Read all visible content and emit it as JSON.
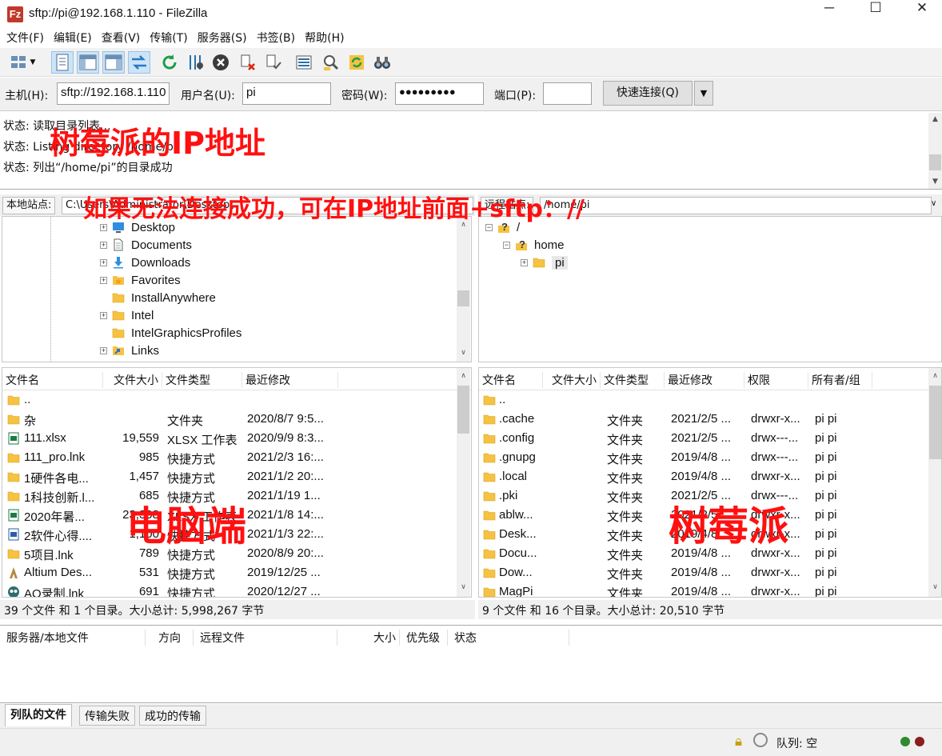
{
  "window": {
    "title": "sftp://pi@192.168.1.110 - FileZilla",
    "app_icon_letter": "Fz",
    "minimize": "─",
    "maximize": "☐",
    "close": "✕"
  },
  "menu": [
    "文件(F)",
    "编辑(E)",
    "查看(V)",
    "传输(T)",
    "服务器(S)",
    "书签(B)",
    "帮助(H)"
  ],
  "quickconnect": {
    "host_label": "主机(H):",
    "host_value": "sftp://192.168.1.110",
    "user_label": "用户名(U):",
    "user_value": "pi",
    "pass_label": "密码(W):",
    "pass_value": "●●●●●●●●●",
    "port_label": "端口(P):",
    "port_value": "",
    "connect_button": "快速连接(Q)",
    "dropdown": "▼"
  },
  "log": [
    {
      "prefix": "状态:",
      "text": "读取目录列表..."
    },
    {
      "prefix": "状态:",
      "text": "Listing directory /home/pi"
    },
    {
      "prefix": "状态:",
      "text": "列出“/home/pi”的目录成功"
    }
  ],
  "local_site": {
    "label": "本地站点:",
    "path": "C:\\Users\\Administrator\\Desktop\\"
  },
  "remote_site": {
    "label": "远程站点:",
    "path": "/home/pi"
  },
  "local_tree": [
    {
      "name": "Desktop",
      "expander": "+",
      "icon": "desktop-icon"
    },
    {
      "name": "Documents",
      "expander": "+",
      "icon": "document-icon"
    },
    {
      "name": "Downloads",
      "expander": "+",
      "icon": "download-icon"
    },
    {
      "name": "Favorites",
      "expander": "+",
      "icon": "favorites-icon"
    },
    {
      "name": "InstallAnywhere",
      "expander": "",
      "icon": "folder-icon"
    },
    {
      "name": "Intel",
      "expander": "+",
      "icon": "folder-icon"
    },
    {
      "name": "IntelGraphicsProfiles",
      "expander": "",
      "icon": "folder-icon"
    },
    {
      "name": "Links",
      "expander": "+",
      "icon": "links-icon"
    }
  ],
  "remote_tree": [
    {
      "name": "/",
      "expander": "−",
      "icon": "unknown-folder-icon"
    },
    {
      "name": "home",
      "expander": "−",
      "icon": "unknown-folder-icon"
    },
    {
      "name": "pi",
      "expander": "+",
      "icon": "folder-icon"
    }
  ],
  "local_headers": [
    "文件名",
    "文件大小",
    "文件类型",
    "最近修改"
  ],
  "local_files": [
    {
      "name": "..",
      "size": "",
      "type": "",
      "modified": "",
      "icon": "folder-icon"
    },
    {
      "name": "杂",
      "size": "",
      "type": "文件夹",
      "modified": "2020/8/7 9:5...",
      "icon": "folder-icon"
    },
    {
      "name": "111.xlsx",
      "size": "19,559",
      "type": "XLSX 工作表",
      "modified": "2020/9/9 8:3...",
      "icon": "excel-icon"
    },
    {
      "name": "111_pro.lnk",
      "size": "985",
      "type": "快捷方式",
      "modified": "2021/2/3 16:...",
      "icon": "folder-icon"
    },
    {
      "name": "1硬件各电...",
      "size": "1,457",
      "type": "快捷方式",
      "modified": "2021/1/2 20:...",
      "icon": "folder-icon"
    },
    {
      "name": "1科技创新.l...",
      "size": "685",
      "type": "快捷方式",
      "modified": "2021/1/19 1...",
      "icon": "folder-icon"
    },
    {
      "name": "2020年暑...",
      "size": "23,308",
      "type": "XLSX 工作表",
      "modified": "2021/1/8 14:...",
      "icon": "excel-icon"
    },
    {
      "name": "2软件心得....",
      "size": "1,100",
      "type": "快捷方式",
      "modified": "2021/1/3 22:...",
      "icon": "word-icon"
    },
    {
      "name": "5项目.lnk",
      "size": "789",
      "type": "快捷方式",
      "modified": "2020/8/9 20:...",
      "icon": "folder-icon"
    },
    {
      "name": "Altium Des...",
      "size": "531",
      "type": "快捷方式",
      "modified": "2019/12/25 ...",
      "icon": "altium-icon"
    },
    {
      "name": "AQ录制.lnk",
      "size": "691",
      "type": "快捷方式",
      "modified": "2020/12/27 ...",
      "icon": "recorder-icon"
    }
  ],
  "local_status": "39 个文件 和 1 个目录。大小总计: 5,998,267 字节",
  "remote_headers": [
    "文件名",
    "文件大小",
    "文件类型",
    "最近修改",
    "权限",
    "所有者/组"
  ],
  "remote_files": [
    {
      "name": "..",
      "size": "",
      "type": "",
      "modified": "",
      "perm": "",
      "owner": ""
    },
    {
      "name": ".cache",
      "size": "",
      "type": "文件夹",
      "modified": "2021/2/5 ...",
      "perm": "drwxr-x...",
      "owner": "pi pi"
    },
    {
      "name": ".config",
      "size": "",
      "type": "文件夹",
      "modified": "2021/2/5 ...",
      "perm": "drwx---...",
      "owner": "pi pi"
    },
    {
      "name": ".gnupg",
      "size": "",
      "type": "文件夹",
      "modified": "2019/4/8 ...",
      "perm": "drwx---...",
      "owner": "pi pi"
    },
    {
      "name": ".local",
      "size": "",
      "type": "文件夹",
      "modified": "2019/4/8 ...",
      "perm": "drwxr-x...",
      "owner": "pi pi"
    },
    {
      "name": ".pki",
      "size": "",
      "type": "文件夹",
      "modified": "2021/2/5 ...",
      "perm": "drwx---...",
      "owner": "pi pi"
    },
    {
      "name": "ablw...",
      "size": "",
      "type": "文件夹",
      "modified": "2021/2/5 ...",
      "perm": "drwxr-x...",
      "owner": "pi pi"
    },
    {
      "name": "Desk...",
      "size": "",
      "type": "文件夹",
      "modified": "2019/4/8 ...",
      "perm": "drwxr-x...",
      "owner": "pi pi"
    },
    {
      "name": "Docu...",
      "size": "",
      "type": "文件夹",
      "modified": "2019/4/8 ...",
      "perm": "drwxr-x...",
      "owner": "pi pi"
    },
    {
      "name": "Dow...",
      "size": "",
      "type": "文件夹",
      "modified": "2019/4/8 ...",
      "perm": "drwxr-x...",
      "owner": "pi pi"
    },
    {
      "name": "MagPi",
      "size": "",
      "type": "文件夹",
      "modified": "2019/4/8 ...",
      "perm": "drwxr-x...",
      "owner": "pi pi"
    }
  ],
  "remote_status": "9 个文件 和 16 个目录。大小总计: 20,510 字节",
  "queue_headers": [
    "服务器/本地文件",
    "方向",
    "远程文件",
    "大小",
    "优先级",
    "状态"
  ],
  "queue_tabs": [
    "列队的文件",
    "传输失败",
    "成功的传输"
  ],
  "queue_status": "队列: 空",
  "annotations": {
    "ip": "树莓派的IP地址",
    "hint": "如果无法连接成功，可在IP地址前面+sftp：//",
    "pc": "电脑端",
    "pi": "树莓派"
  },
  "colors": {
    "annotation": "#ff1010",
    "folder": "#f5c242",
    "accent": "#0078d7"
  }
}
